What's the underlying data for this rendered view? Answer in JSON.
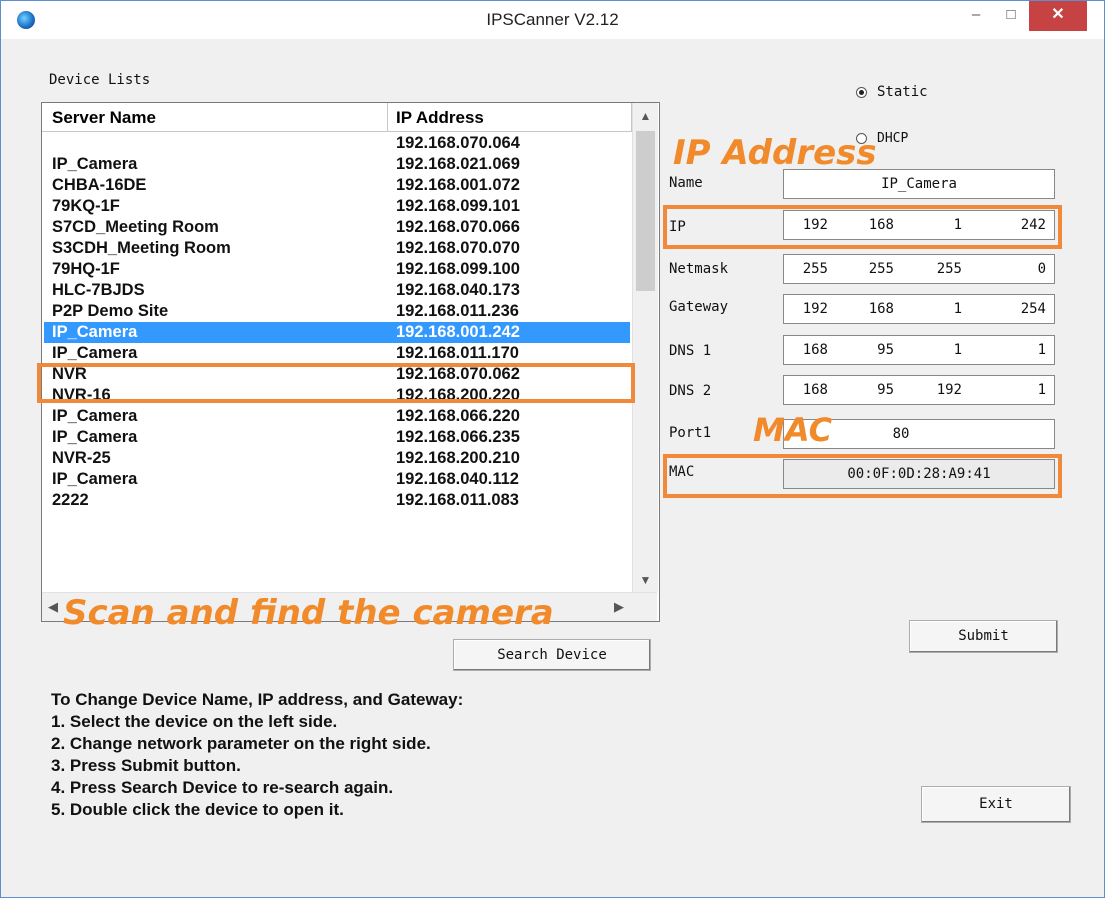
{
  "window": {
    "title": "IPSCanner V2.12",
    "minimize": "–",
    "maximize": "□",
    "close": "✕"
  },
  "device_list": {
    "label": "Device Lists",
    "columns": [
      "Server Name",
      "IP Address"
    ],
    "rows": [
      {
        "name": "",
        "ip": "192.168.070.064"
      },
      {
        "name": "IP_Camera",
        "ip": "192.168.021.069"
      },
      {
        "name": "CHBA-16DE",
        "ip": "192.168.001.072"
      },
      {
        "name": "79KQ-1F",
        "ip": "192.168.099.101"
      },
      {
        "name": "S7CD_Meeting Room",
        "ip": "192.168.070.066"
      },
      {
        "name": "S3CDH_Meeting Room",
        "ip": "192.168.070.070"
      },
      {
        "name": "79HQ-1F",
        "ip": "192.168.099.100"
      },
      {
        "name": "HLC-7BJDS",
        "ip": "192.168.040.173"
      },
      {
        "name": "P2P Demo Site",
        "ip": "192.168.011.236"
      },
      {
        "name": "IP_Camera",
        "ip": "192.168.001.242"
      },
      {
        "name": "IP_Camera",
        "ip": "192.168.011.170"
      },
      {
        "name": "NVR",
        "ip": "192.168.070.062"
      },
      {
        "name": "NVR-16",
        "ip": "192.168.200.220"
      },
      {
        "name": "IP_Camera",
        "ip": "192.168.066.220"
      },
      {
        "name": "IP_Camera",
        "ip": "192.168.066.235"
      },
      {
        "name": "NVR-25",
        "ip": "192.168.200.210"
      },
      {
        "name": "IP_Camera",
        "ip": "192.168.040.112"
      },
      {
        "name": "2222",
        "ip": "192.168.011.083"
      }
    ],
    "selected_index": 9
  },
  "search_button": "Search Device",
  "instructions": [
    "To Change Device Name, IP address, and Gateway:",
    "1. Select the device on the left side.",
    "2. Change network parameter on the right side.",
    "3. Press Submit button.",
    "4. Press Search Device to re-search again.",
    "5. Double click the device to open it."
  ],
  "network": {
    "static_label": "Static",
    "dhcp_label": "DHCP",
    "mode": "Static",
    "name_label": "Name",
    "name_value": "IP_Camera",
    "ip_label": "IP",
    "ip": [
      "192",
      "168",
      "1",
      "242"
    ],
    "netmask_label": "Netmask",
    "netmask": [
      "255",
      "255",
      "255",
      "0"
    ],
    "gateway_label": "Gateway",
    "gateway": [
      "192",
      "168",
      "1",
      "254"
    ],
    "dns1_label": "DNS 1",
    "dns1": [
      "168",
      "95",
      "1",
      "1"
    ],
    "dns2_label": "DNS 2",
    "dns2": [
      "168",
      "95",
      "192",
      "1"
    ],
    "port_label": "Port1",
    "port_value": "80",
    "mac_label": "MAC",
    "mac_value": "00:0F:0D:28:A9:41"
  },
  "submit_button": "Submit",
  "exit_button": "Exit",
  "annotations": {
    "ip_address": "IP Address",
    "mac": "MAC",
    "scan": "Scan and find the camera",
    "color": "#f08a3a"
  }
}
